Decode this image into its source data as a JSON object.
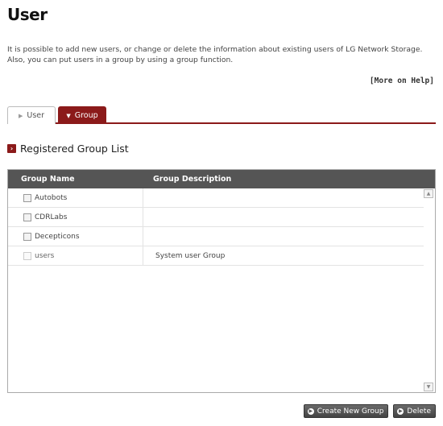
{
  "page": {
    "title": "User",
    "intro": "It is possible to add new users, or change or delete the information about existing users of LG Network Storage. Also, you can put users in a group by using a group function.",
    "help_link": "[More on Help]"
  },
  "tabs": [
    {
      "label": "User",
      "active": false
    },
    {
      "label": "Group",
      "active": true
    }
  ],
  "section": {
    "heading": "Registered Group List"
  },
  "table": {
    "columns": [
      "Group Name",
      "Group Description"
    ],
    "rows": [
      {
        "name": "Autobots",
        "description": "",
        "checked": false,
        "enabled": true
      },
      {
        "name": "CDRLabs",
        "description": "",
        "checked": false,
        "enabled": true
      },
      {
        "name": "Decepticons",
        "description": "",
        "checked": false,
        "enabled": true
      },
      {
        "name": "users",
        "description": "System user Group",
        "checked": false,
        "enabled": false
      }
    ]
  },
  "actions": {
    "create_label": "Create New Group",
    "delete_label": "Delete"
  },
  "colors": {
    "accent": "#8b1a1a",
    "header_bg": "#555555"
  }
}
